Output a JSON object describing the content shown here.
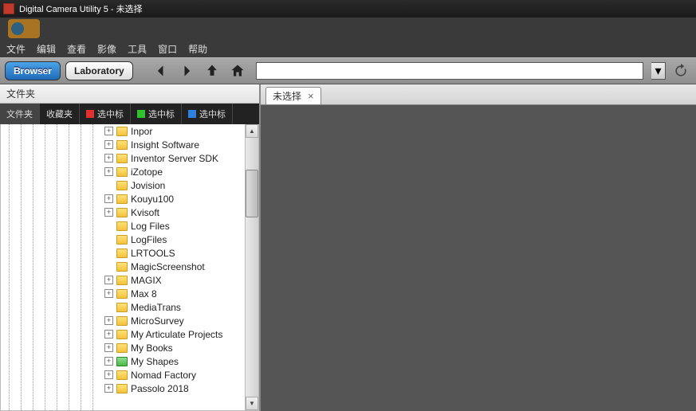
{
  "window": {
    "title": "Digital Camera Utility 5 - 未选择"
  },
  "menu": {
    "items": [
      "文件",
      "编辑",
      "查看",
      "影像",
      "工具",
      "窗口",
      "帮助"
    ]
  },
  "toolbar": {
    "browser_label": "Browser",
    "laboratory_label": "Laboratory"
  },
  "left": {
    "header": "文件夹",
    "tabs": [
      {
        "label": "文件夹",
        "flag": ""
      },
      {
        "label": "收藏夹",
        "flag": ""
      },
      {
        "label": "选中标",
        "flag": "red"
      },
      {
        "label": "选中标",
        "flag": "green"
      },
      {
        "label": "选中标",
        "flag": "blue"
      }
    ],
    "tree": [
      {
        "name": "Inpor",
        "exp": "+"
      },
      {
        "name": "Insight Software",
        "exp": "+"
      },
      {
        "name": "Inventor Server SDK",
        "exp": "+"
      },
      {
        "name": "iZotope",
        "exp": "+"
      },
      {
        "name": "Jovision",
        "exp": ""
      },
      {
        "name": "Kouyu100",
        "exp": "+"
      },
      {
        "name": "Kvisoft",
        "exp": "+"
      },
      {
        "name": "Log Files",
        "exp": ""
      },
      {
        "name": "LogFiles",
        "exp": ""
      },
      {
        "name": "LRTOOLS",
        "exp": ""
      },
      {
        "name": "MagicScreenshot",
        "exp": ""
      },
      {
        "name": "MAGIX",
        "exp": "+"
      },
      {
        "name": "Max 8",
        "exp": "+"
      },
      {
        "name": "MediaTrans",
        "exp": ""
      },
      {
        "name": "MicroSurvey",
        "exp": "+"
      },
      {
        "name": "My Articulate Projects",
        "exp": "+"
      },
      {
        "name": "My Books",
        "exp": "+"
      },
      {
        "name": "My Shapes",
        "exp": "+",
        "special": true
      },
      {
        "name": "Nomad Factory",
        "exp": "+"
      },
      {
        "name": "Passolo 2018",
        "exp": "+"
      }
    ]
  },
  "right": {
    "tab_label": "未选择",
    "close": "×"
  }
}
